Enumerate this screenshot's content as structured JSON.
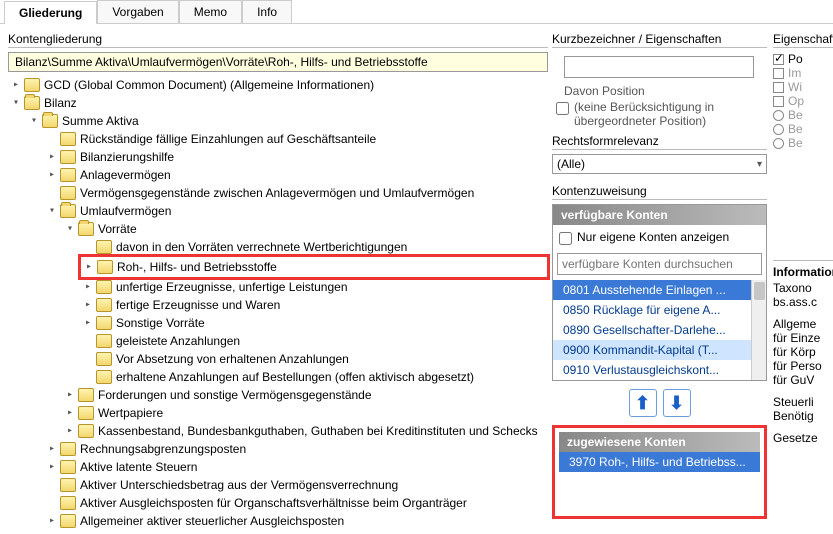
{
  "tabs": {
    "t0": "Gliederung",
    "t1": "Vorgaben",
    "t2": "Memo",
    "t3": "Info"
  },
  "left": {
    "heading": "Kontengliederung",
    "path": "Bilanz\\Summe Aktiva\\Umlaufvermögen\\Vorräte\\Roh-, Hilfs- und Betriebsstoffe",
    "tree": {
      "gcd": "GCD (Global Common Document) (Allgemeine Informationen)",
      "bilanz": "Bilanz",
      "summe_aktiva": "Summe Aktiva",
      "items": {
        "a0": "Rückständige fällige Einzahlungen auf Geschäftsanteile",
        "a1": "Bilanzierungshilfe",
        "a2": "Anlagevermögen",
        "a3": "Vermögensgegenstände zwischen Anlagevermögen und Umlaufvermögen",
        "a4": "Umlaufvermögen",
        "vorraete": "Vorräte",
        "v0": "davon in den Vorräten verrechnete Wertberichtigungen",
        "v1": "Roh-, Hilfs- und Betriebsstoffe",
        "v2": "unfertige Erzeugnisse, unfertige Leistungen",
        "v3": "fertige Erzeugnisse und Waren",
        "v4": "Sonstige Vorräte",
        "v5": "geleistete Anzahlungen",
        "v6": "Vor Absetzung von erhaltenen Anzahlungen",
        "v7": "erhaltene Anzahlungen auf Bestellungen (offen aktivisch abgesetzt)",
        "u1": "Forderungen und sonstige Vermögensgegenstände",
        "u2": "Wertpapiere",
        "u3": "Kassenbestand, Bundesbankguthaben, Guthaben bei Kreditinstituten und Schecks",
        "a5": "Rechnungsabgrenzungsposten",
        "a6": "Aktive latente Steuern",
        "a7": "Aktiver Unterschiedsbetrag aus der Vermögensverrechnung",
        "a8": "Aktiver Ausgleichsposten für Organschaftsverhältnisse beim Organträger",
        "a9": "Allgemeiner aktiver steuerlicher Ausgleichsposten"
      }
    }
  },
  "mid": {
    "kurz_heading": "Kurzbezeichner / Eigenschaften",
    "davon_label": "Davon Position",
    "davon_sub": "(keine Berücksichtigung in übergeordneter Position)",
    "rechts_heading": "Rechtsformrelevanz",
    "rechts_value": "(Alle)",
    "zuweisung_heading": "Kontenzuweisung",
    "verfuegbar_head": "verfügbare Konten",
    "only_own": "Nur eigene Konten anzeigen",
    "search_placeholder": "verfügbare Konten durchsuchen",
    "avail": {
      "k0": "0801 Ausstehende Einlagen ...",
      "k1": "0850 Rücklage für eigene A...",
      "k2": "0890 Gesellschafter-Darlehe...",
      "k3": "0900 Kommandit-Kapital (T...",
      "k4": "0910 Verlustausgleichskont..."
    },
    "zugewiesen_head": "zugewiesene Konten",
    "assigned": {
      "z0": "3970 Roh-, Hilfs- und Betriebss..."
    }
  },
  "right": {
    "heading": "Eigenschaften",
    "p0": "Po",
    "p1": "Im",
    "p2": "Wi",
    "p3": "Op",
    "p4": "Be",
    "p5": "Be",
    "p6": "Be",
    "info_head": "Informationen",
    "taxo": "Taxono",
    "bsass": "bs.ass.c",
    "allg": "Allgeme",
    "einz": "für Einze",
    "korp": "für Körp",
    "pers": "für Perso",
    "guv": "für GuV",
    "steuer": "Steuerli",
    "benoet": "Benötig",
    "gesetz": "Gesetze"
  }
}
